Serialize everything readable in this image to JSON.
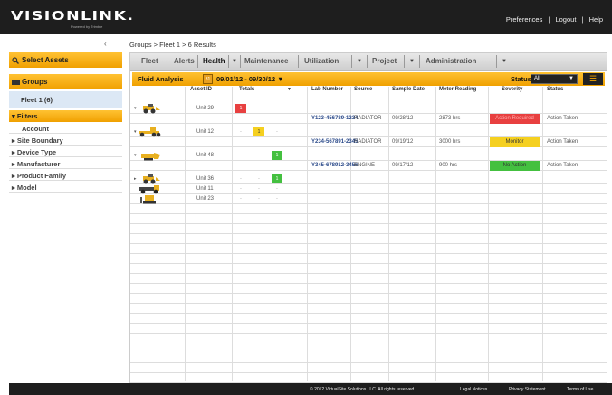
{
  "header": {
    "logo": "VISIONLINK.",
    "logo_sub": "Powered by Trimble",
    "links": [
      "Preferences",
      "|",
      "Logout",
      "|",
      "Help"
    ]
  },
  "sidebar": {
    "collapse_icon": "chevron-left-icon",
    "select_assets": "Select Assets",
    "groups": "Groups",
    "fleet": "Fleet 1 (6)",
    "filters": "Filters",
    "account": "Account",
    "items": [
      "Site Boundary",
      "Device Type",
      "Manufacturer",
      "Product Family",
      "Model"
    ]
  },
  "breadcrumb": "Groups > Fleet 1 > 6 Results",
  "tabs": [
    {
      "label": "Fleet"
    },
    {
      "label": "Alerts"
    },
    {
      "label": "Health"
    },
    {
      "label": "Maintenance"
    },
    {
      "label": "Utilization"
    },
    {
      "label": "Project"
    },
    {
      "label": "Administration"
    }
  ],
  "subbar": {
    "tab": "Fluid Analysis",
    "date_range": "09/01/12 - 09/30/12",
    "status_label": "Status:",
    "status_value": "All"
  },
  "columns": [
    "Asset ID",
    "Totals",
    "Lab Number",
    "Source",
    "Sample Date",
    "Meter Reading",
    "Severity",
    "Status"
  ],
  "assets": [
    {
      "id": "Unit 29",
      "equipment": "wheel-loader-icon",
      "totals": [
        "1",
        "-",
        "-"
      ]
    },
    {
      "id": "Unit 12",
      "equipment": "motor-grader-icon",
      "totals": [
        "-",
        "1",
        "-"
      ]
    },
    {
      "id": "Unit 48",
      "equipment": "loader-icon",
      "totals": [
        "-",
        "-",
        "1"
      ]
    },
    {
      "id": "Unit 36",
      "equipment": "wheel-loader-icon",
      "totals": [
        "-",
        "-",
        "1"
      ]
    },
    {
      "id": "Unit 11",
      "equipment": "truck-icon",
      "totals": [
        "-",
        "-",
        "-"
      ]
    },
    {
      "id": "Unit 23",
      "equipment": "dozer-icon",
      "totals": [
        "-",
        "-",
        "-"
      ]
    }
  ],
  "samples": [
    {
      "lab": "Y123-456789-1234",
      "source": "RADIATOR",
      "date": "09/28/12",
      "meter": "2873 hrs",
      "severity": "Action Required",
      "status": "Action Taken"
    },
    {
      "lab": "Y234-567891-2345",
      "source": "RADIATOR",
      "date": "09/19/12",
      "meter": "3000 hrs",
      "severity": "Monitor",
      "status": "Action Taken"
    },
    {
      "lab": "Y345-678912-3456",
      "source": "ENGINE",
      "date": "09/17/12",
      "meter": "900 hrs",
      "severity": "No Action",
      "status": "Action Taken"
    }
  ],
  "colors": {
    "accent": "#f0a000",
    "red": "#e84040",
    "yellow": "#f5d020",
    "green": "#44c040"
  },
  "footer": {
    "copyright": "© 2012 VirtualSite Solutions LLC. All rights reserved.",
    "links": [
      "Legal Notices",
      "Privacy Statement",
      "Terms of Use"
    ]
  }
}
